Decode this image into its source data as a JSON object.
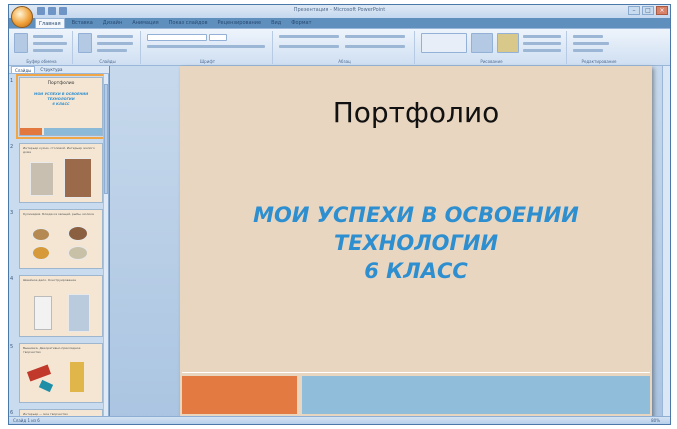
{
  "window": {
    "title": "Презентация - Microsoft PowerPoint"
  },
  "ribbon": {
    "tabs": [
      "Главная",
      "Вставка",
      "Дизайн",
      "Анимация",
      "Показ слайдов",
      "Рецензирование",
      "Вид",
      "Формат"
    ],
    "groups": [
      "Буфер обмена",
      "Слайды",
      "Шрифт",
      "Абзац",
      "Рисование",
      "Редактирование"
    ]
  },
  "panel": {
    "tabs": [
      "Слайды",
      "Структура"
    ]
  },
  "thumbnails": [
    {
      "num": "1",
      "title": "Портфолио",
      "subtitle": "МОИ УСПЕХИ В ОСВОЕНИИ\nТЕХНОЛОГИИ\n6 КЛАСС"
    },
    {
      "num": "2",
      "heading": "Интерьер кухни, столовой. Интерьер жилого дома"
    },
    {
      "num": "3",
      "heading": "Кулинария. Блюда из овощей, рыбы, молока"
    },
    {
      "num": "4",
      "heading": "Швейное дело. Конструирование"
    },
    {
      "num": "5",
      "heading": "Вышивка. Декоративно-прикладное творчество"
    },
    {
      "num": "6",
      "heading": "Интерьер — мое творчество"
    }
  ],
  "slide": {
    "title": "Портфолио",
    "subtitle": "МОИ УСПЕХИ В ОСВОЕНИИ\nТЕХНОЛОГИИ\n6 КЛАСС",
    "accent_orange": "#e27a41",
    "accent_blue": "#8fbdda",
    "background": "#e9d6c1"
  },
  "status": {
    "left": "Слайд 1 из 6",
    "zoom": "80%"
  }
}
